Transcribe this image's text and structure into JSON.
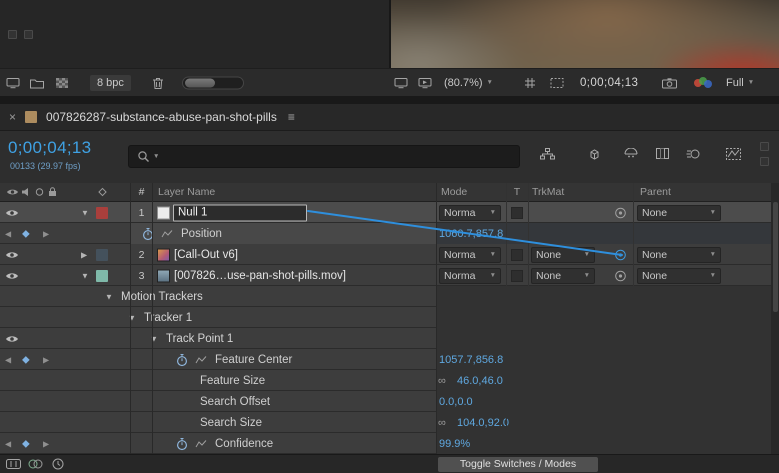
{
  "viewer_toolbar": {
    "bpc_label": "8 bpc",
    "zoom_label": "(80.7%)",
    "timecode": "0;00;04;13",
    "resolution_label": "Full"
  },
  "tab": {
    "title": "007826287-substance-abuse-pan-shot-pills"
  },
  "timeline_header": {
    "timecode": "0;00;04;13",
    "frame_info": "00133 (29.97 fps)"
  },
  "columns": {
    "number": "#",
    "layer_name": "Layer Name",
    "mode": "Mode",
    "t": "T",
    "trkmat": "TrkMat",
    "parent": "Parent"
  },
  "rows": [
    {
      "num": "1",
      "name": "Null 1",
      "mode": "Norma",
      "parent": "None"
    },
    {
      "name": "Position",
      "value": "1060.7,857.8"
    },
    {
      "num": "2",
      "name": "[Call-Out v6]",
      "mode": "Norma",
      "trkmat": "None",
      "parent": "None"
    },
    {
      "num": "3",
      "name": "[007826…use-pan-shot-pills.mov]",
      "mode": "Norma",
      "trkmat": "None",
      "parent": "None"
    },
    {
      "name": "Motion Trackers"
    },
    {
      "name": "Tracker 1"
    },
    {
      "name": "Track Point 1"
    },
    {
      "name": "Feature Center",
      "value": "1057.7,856.8"
    },
    {
      "name": "Feature Size",
      "value": "46.0,46.0"
    },
    {
      "name": "Search Offset",
      "value": "0.0,0.0"
    },
    {
      "name": "Search Size",
      "value": "104.0,92.0"
    },
    {
      "name": "Confidence",
      "value": "99.9%"
    }
  ],
  "bottom_bar": {
    "toggle_label": "Toggle Switches / Modes"
  },
  "icons": {
    "close": "×",
    "menu": "≡",
    "chevron_down": "▼",
    "tri_open": "▼",
    "tri_closed": "▶",
    "kf_prev": "◀",
    "kf_next": "▶",
    "kf_diamond": "◆",
    "link": "∞"
  },
  "colors": {
    "value_blue": "#5fa8e0",
    "timecode_blue": "#3fa1e3",
    "label_red": "#a93f3c",
    "label_teal": "#7fb9a9",
    "pickwhip_active": "#3e9be0"
  }
}
